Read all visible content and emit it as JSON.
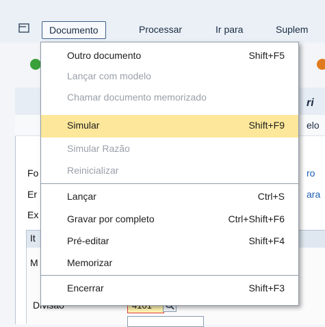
{
  "menubar": {
    "items": [
      {
        "label": "Documento"
      },
      {
        "label": "Processar"
      },
      {
        "label": "Ir para"
      },
      {
        "label": "Suplem"
      }
    ]
  },
  "dropdown": {
    "items": [
      {
        "label": "Outro documento",
        "shortcut": "Shift+F5",
        "enabled": true
      },
      {
        "label": "Lançar com modelo",
        "shortcut": "",
        "enabled": false
      },
      {
        "label": "Chamar documento memorizado",
        "shortcut": "",
        "enabled": false
      },
      {
        "label": "Simular",
        "shortcut": "Shift+F9",
        "enabled": true,
        "highlighted": true
      },
      {
        "label": "Simular Razão",
        "shortcut": "",
        "enabled": false
      },
      {
        "label": "Reinicializar",
        "shortcut": "",
        "enabled": false
      },
      {
        "label": "Lançar",
        "shortcut": "Ctrl+S",
        "enabled": true
      },
      {
        "label": "Gravar por completo",
        "shortcut": "Ctrl+Shift+F6",
        "enabled": true
      },
      {
        "label": "Pré-editar",
        "shortcut": "Shift+F4",
        "enabled": true
      },
      {
        "label": "Memorizar",
        "shortcut": "",
        "enabled": true
      },
      {
        "label": "Encerrar",
        "shortcut": "Shift+F3",
        "enabled": true
      }
    ]
  },
  "background": {
    "labels": [
      "Fo",
      "Er",
      "Ex",
      "It",
      "M"
    ],
    "right_texts": [
      "ri",
      "elo",
      "ro",
      "ara"
    ],
    "field_label": "Divisão",
    "field_value": "4101"
  },
  "colors": {
    "highlight": "#fce79a",
    "disabled_text": "#9aa0a8",
    "menubar_bg": "#eaf0f6"
  }
}
